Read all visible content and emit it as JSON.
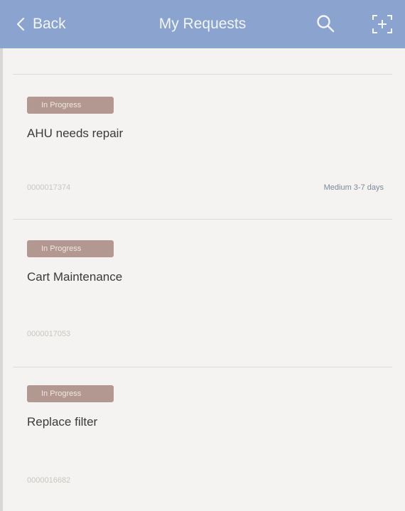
{
  "header": {
    "back_label": "Back",
    "title": "My Requests",
    "background_color": "#8aa3cf"
  },
  "icons": {
    "back": "chevron-left-icon",
    "search": "search-icon",
    "scan": "scan-add-icon"
  },
  "requests": [
    {
      "status": "In Progress",
      "title": "AHU needs repair",
      "id": "0000017374",
      "priority": "Medium 3-7 days"
    },
    {
      "status": "In Progress",
      "title": "Cart Maintenance",
      "id": "0000017053",
      "priority": ""
    },
    {
      "status": "In Progress",
      "title": "Replace filter",
      "id": "0000016682",
      "priority": ""
    }
  ],
  "colors": {
    "status_badge": "#b29891",
    "title_text": "#3a3a3a",
    "id_text": "#c8c6c2"
  }
}
